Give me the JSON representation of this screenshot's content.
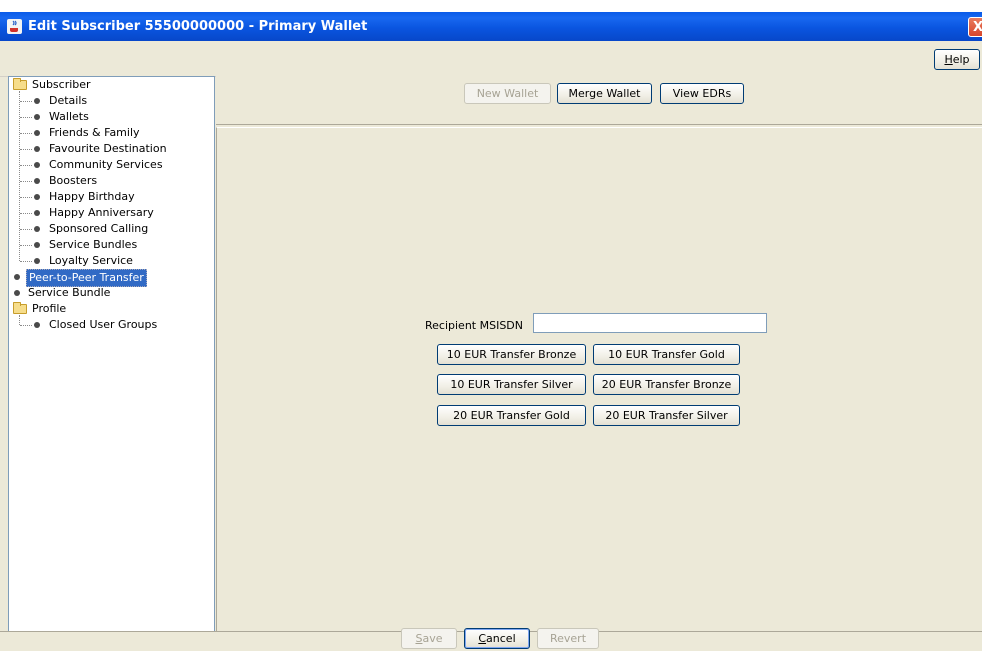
{
  "window": {
    "title": "Edit Subscriber 55500000000 - Primary Wallet",
    "close_label": "X",
    "app_icon": "java-cup-icon"
  },
  "help": {
    "label_prefix": "",
    "label_mnemonic": "H",
    "label_rest": "elp"
  },
  "tree": {
    "root": "Subscriber",
    "children": [
      "Details",
      "Wallets",
      "Friends & Family",
      "Favourite Destination",
      "Community Services",
      "Boosters",
      "Happy Birthday",
      "Happy Anniversary",
      "Sponsored Calling",
      "Service Bundles",
      "Loyalty Service"
    ],
    "peer": "Peer-to-Peer Transfer",
    "service_bundle": "Service Bundle",
    "profile": "Profile",
    "profile_children": [
      "Closed User Groups"
    ]
  },
  "toolbar": {
    "new_wallet": "New Wallet",
    "merge_wallet": "Merge Wallet",
    "view_edrs": "View EDRs"
  },
  "transfer": {
    "recipient_label": "Recipient MSISDN",
    "recipient_value": "",
    "buttons": [
      "10 EUR Transfer Bronze",
      "10 EUR Transfer Gold",
      "10 EUR Transfer Silver",
      "20 EUR Transfer Bronze",
      "20 EUR Transfer Gold",
      "20 EUR Transfer Silver"
    ]
  },
  "footer": {
    "save_m": "S",
    "save_rest": "ave",
    "cancel_m": "C",
    "cancel_rest": "ancel",
    "revert": "Revert"
  },
  "colors": {
    "titlebar": "#0a55e0",
    "selection": "#316ac5",
    "panel": "#ece9d8"
  }
}
